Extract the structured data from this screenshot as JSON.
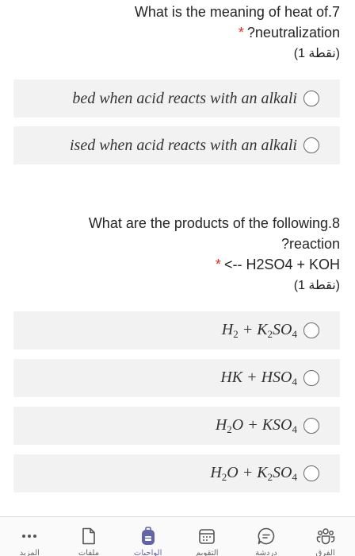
{
  "question7": {
    "line1": "What is the meaning of heat of.7",
    "line2": "?neutralization",
    "required": "*",
    "points": "(1 نقطة)",
    "options": [
      {
        "text": "bed when acid reacts with an alkali"
      },
      {
        "text": "ised when acid reacts with an alkali"
      }
    ]
  },
  "question8": {
    "line1": "What are the products of the following.8",
    "line2": "?reaction",
    "line3": "<-- H2SO4 + KOH",
    "required": "*",
    "points": "(1 نقطة)",
    "options": [
      {
        "parts": [
          "H",
          "2",
          " + K",
          "2",
          "SO",
          "4"
        ]
      },
      {
        "parts": [
          "HK + HSO",
          "4"
        ]
      },
      {
        "parts": [
          "H",
          "2",
          "O + KSO",
          "4"
        ]
      },
      {
        "parts": [
          "H",
          "2",
          "O + K",
          "2",
          "SO",
          "4"
        ]
      }
    ]
  },
  "bottom_nav": {
    "items": [
      {
        "label": "المزيد",
        "icon": "more-icon"
      },
      {
        "label": "ملفات",
        "icon": "file-icon"
      },
      {
        "label": "الواجبات",
        "icon": "backpack-icon"
      },
      {
        "label": "التقويم",
        "icon": "calendar-icon"
      },
      {
        "label": "دردشة",
        "icon": "chat-icon"
      },
      {
        "label": "الفرق",
        "icon": "teams-icon"
      }
    ]
  }
}
